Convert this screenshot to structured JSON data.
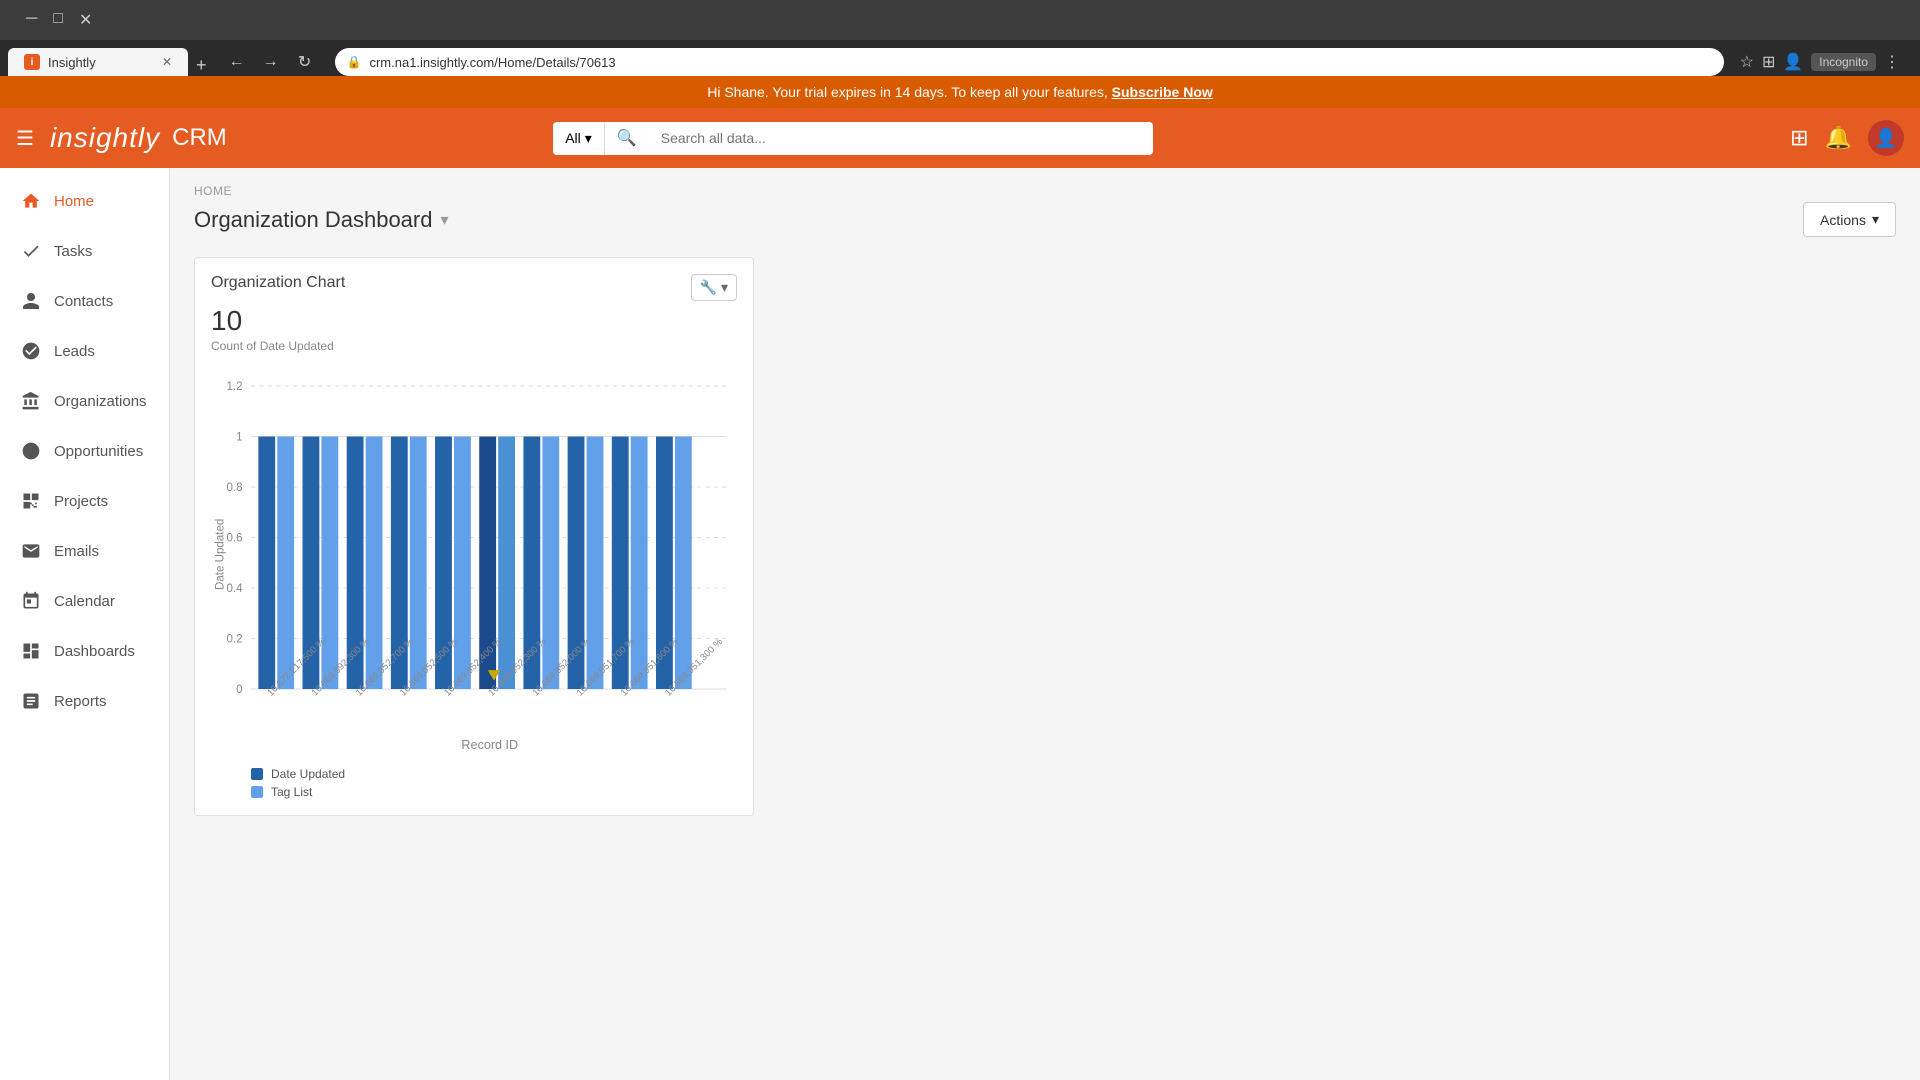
{
  "browser": {
    "tab_title": "Insightly",
    "url": "crm.na1.insightly.com/Home/Details/70613",
    "incognito_label": "Incognito",
    "new_tab_symbol": "+"
  },
  "trial_banner": {
    "message": "Hi Shane. Your trial expires in 14 days. To keep all your features,",
    "cta_text": "Subscribe Now"
  },
  "header": {
    "logo_text": "insightly",
    "crm_text": "CRM",
    "search_placeholder": "Search all data...",
    "search_dropdown": "All"
  },
  "sidebar": {
    "items": [
      {
        "id": "home",
        "label": "Home",
        "icon": "home-icon"
      },
      {
        "id": "tasks",
        "label": "Tasks",
        "icon": "tasks-icon"
      },
      {
        "id": "contacts",
        "label": "Contacts",
        "icon": "contacts-icon"
      },
      {
        "id": "leads",
        "label": "Leads",
        "icon": "leads-icon"
      },
      {
        "id": "organizations",
        "label": "Organizations",
        "icon": "orgs-icon"
      },
      {
        "id": "opportunities",
        "label": "Opportunities",
        "icon": "opps-icon"
      },
      {
        "id": "projects",
        "label": "Projects",
        "icon": "projects-icon"
      },
      {
        "id": "emails",
        "label": "Emails",
        "icon": "emails-icon"
      },
      {
        "id": "calendar",
        "label": "Calendar",
        "icon": "calendar-icon"
      },
      {
        "id": "dashboards",
        "label": "Dashboards",
        "icon": "dashboards-icon"
      },
      {
        "id": "reports",
        "label": "Reports",
        "icon": "reports-icon"
      }
    ]
  },
  "breadcrumb": "HOME",
  "page_title": "Organization Dashboard",
  "actions_button": "Actions",
  "chart": {
    "title": "Organization Chart",
    "count": "10",
    "subtitle": "Count of Date Updated",
    "y_axis_labels": [
      "0",
      "0.2",
      "0.4",
      "0.6",
      "0.8",
      "1",
      "1.2"
    ],
    "y_axis_title": "Date Updated",
    "x_axis_title": "Record ID",
    "legend": [
      {
        "label": "Date Updated",
        "color": "#1a5fb4"
      },
      {
        "label": "Tag List",
        "color": "#62a0ea"
      }
    ],
    "bars": [
      {
        "id": "16,672,217,500 %",
        "dark": 1,
        "light": 1
      },
      {
        "id": "16,669,992,300 %",
        "dark": 1,
        "light": 1
      },
      {
        "id": "16,669,952,700 %",
        "dark": 1,
        "light": 1
      },
      {
        "id": "16,669,952,500 %",
        "dark": 1,
        "light": 1
      },
      {
        "id": "16,669,952,400 %",
        "dark": 1,
        "light": 1
      },
      {
        "id": "16,669,952,300 %",
        "dark": 1,
        "light": 1
      },
      {
        "id": "16,669,952,000 %",
        "dark": 1,
        "light": 1
      },
      {
        "id": "16,669,951,700 %",
        "dark": 1,
        "light": 1
      },
      {
        "id": "16,669,951,600 %",
        "dark": 1,
        "light": 1
      },
      {
        "id": "16,669,951,300 %",
        "dark": 1,
        "light": 1
      }
    ],
    "accent_colors": {
      "dark_blue": "#2563a8",
      "light_blue": "#5bacd6"
    }
  }
}
